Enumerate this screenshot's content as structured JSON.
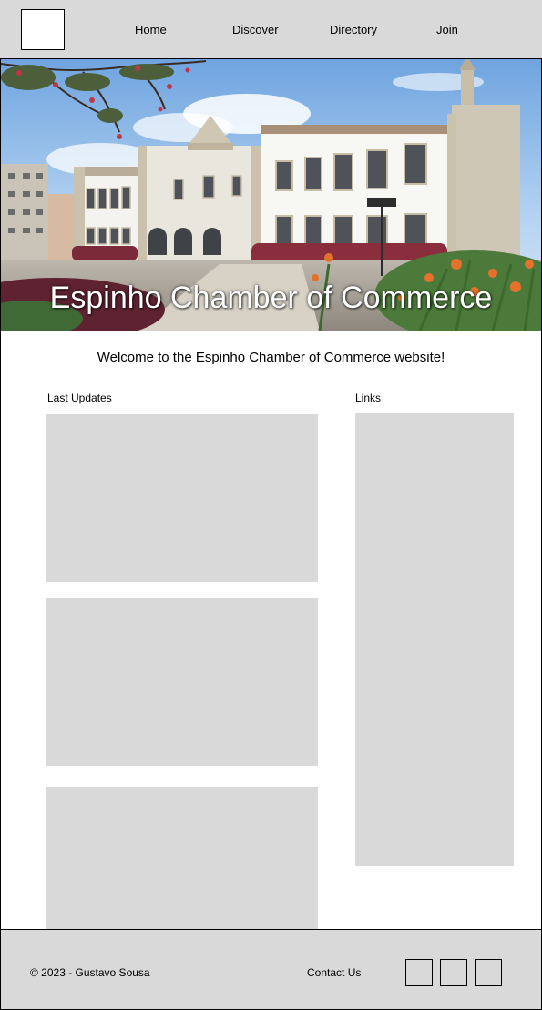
{
  "header": {
    "logo_icon": "logo-placeholder",
    "nav": {
      "home": "Home",
      "discover": "Discover",
      "directory": "Directory",
      "join": "Join"
    }
  },
  "hero": {
    "title": "Espinho Chamber of Commerce",
    "image": "building-photo"
  },
  "main": {
    "welcome": "Welcome to the Espinho Chamber of Commerce website!",
    "updates_label": "Last Updates",
    "links_label": "Links"
  },
  "footer": {
    "copyright": "© 2023 - Gustavo Sousa",
    "contact": "Contact Us",
    "social_icons": [
      "social-icon-placeholder",
      "social-icon-placeholder",
      "social-icon-placeholder"
    ]
  },
  "colors": {
    "panel_gray": "#d9d9d9",
    "border": "#000000",
    "hero_text": "#ffffff"
  }
}
